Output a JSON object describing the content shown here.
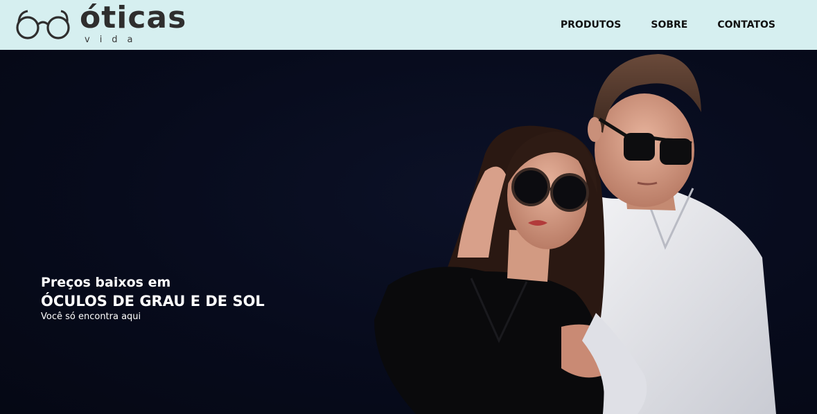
{
  "brand": {
    "name": "óticas",
    "sub": "vida",
    "logo_icon": "glasses-icon"
  },
  "nav": {
    "items": [
      {
        "label": "PRODUTOS"
      },
      {
        "label": "SOBRE"
      },
      {
        "label": "CONTATOS"
      }
    ]
  },
  "hero": {
    "line1": "Preços baixos em",
    "line2": "ÓCULOS DE GRAU E DE SOL",
    "line3": "Você só encontra aqui",
    "image": "couple-wearing-sunglasses-photo"
  },
  "colors": {
    "header_bg": "#d6eff0",
    "hero_bg": "#070b1c",
    "hero_text": "#ffffff",
    "nav_text": "#111111",
    "logo_text": "#2f2e2e"
  }
}
